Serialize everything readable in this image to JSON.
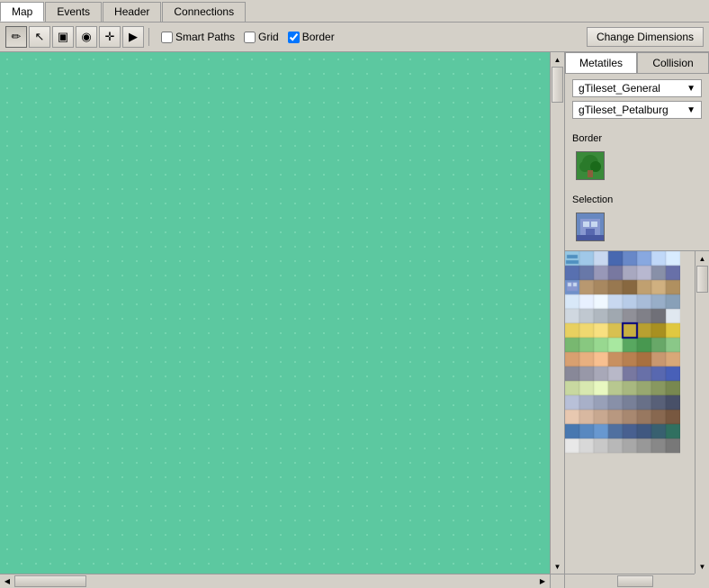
{
  "tabs": [
    {
      "label": "Map",
      "active": true
    },
    {
      "label": "Events",
      "active": false
    },
    {
      "label": "Header",
      "active": false
    },
    {
      "label": "Connections",
      "active": false
    }
  ],
  "toolbar": {
    "tools": [
      {
        "name": "pencil",
        "icon": "✏",
        "active": true
      },
      {
        "name": "pointer",
        "icon": "↖",
        "active": false
      },
      {
        "name": "fill-bucket",
        "icon": "▣",
        "active": false
      },
      {
        "name": "dropper",
        "icon": "◉",
        "active": false
      },
      {
        "name": "move",
        "icon": "✛",
        "active": false
      },
      {
        "name": "forward",
        "icon": "▶",
        "active": false
      }
    ],
    "smart_paths_label": "Smart Paths",
    "smart_paths_checked": false,
    "grid_label": "Grid",
    "grid_checked": false,
    "border_label": "Border",
    "border_checked": true,
    "change_dimensions_label": "Change Dimensions"
  },
  "right_panel": {
    "tabs": [
      {
        "label": "Metatiles",
        "active": true
      },
      {
        "label": "Collision",
        "active": false
      }
    ],
    "tileset1": "gTileset_General",
    "tileset2": "gTileset_Petalburg",
    "border_label": "Border",
    "selection_label": "Selection",
    "border_tile_color": "#5cc8a0",
    "selection_tile_color": "#6090b8"
  },
  "tileset_colors": [
    "#6ab0d8",
    "#a0c0e8",
    "#c8d8f0",
    "#b8c8e0",
    "#d8e8f8",
    "#e8f0f8",
    "#f0f8ff",
    "#dceeff",
    "#a0b8d0",
    "#b0c8e0",
    "#90a8c0",
    "#8898b0",
    "#7888a0",
    "#6878a8",
    "#5870b0",
    "#4868b8",
    "#c8a880",
    "#d8b890",
    "#e8c8a0",
    "#b89870",
    "#a88860",
    "#987850",
    "#886840",
    "#785830",
    "#8898b8",
    "#98a8c8",
    "#a8b8d8",
    "#b8c8e8",
    "#c8d8f8",
    "#d8e8ff",
    "#e8f8ff",
    "#f8ffff",
    "#d0d8e0",
    "#c0c8d0",
    "#b0b8c0",
    "#a0a8b0",
    "#909098",
    "#808088",
    "#707078",
    "#606068",
    "#e8d060",
    "#f0d870",
    "#f8e080",
    "#d8c050",
    "#c8b040",
    "#b8a030",
    "#a89020",
    "#988010",
    "#78b870",
    "#88c880",
    "#98d890",
    "#a8e8a0",
    "#58a860",
    "#489850",
    "#388840",
    "#287830",
    "#d8a070",
    "#e8b080",
    "#f8c090",
    "#c89060",
    "#b88050",
    "#a87040",
    "#986030",
    "#885020",
    "#888898",
    "#9898a8",
    "#a8a8b8",
    "#b8b8c8",
    "#7878a0",
    "#6870a8",
    "#5868b0",
    "#4860b8",
    "#c8d8a0",
    "#d8e8b0",
    "#e8f8c0",
    "#b8c890",
    "#a8b880",
    "#98a870",
    "#889860",
    "#788850",
    "#b8c0d8",
    "#a8b0c8",
    "#98a0b8",
    "#8890a8",
    "#788098",
    "#687088",
    "#586078",
    "#485068",
    "#e8c8b0",
    "#d8b8a0",
    "#c8a890",
    "#b89880",
    "#a88870",
    "#987860",
    "#886850",
    "#785840"
  ]
}
